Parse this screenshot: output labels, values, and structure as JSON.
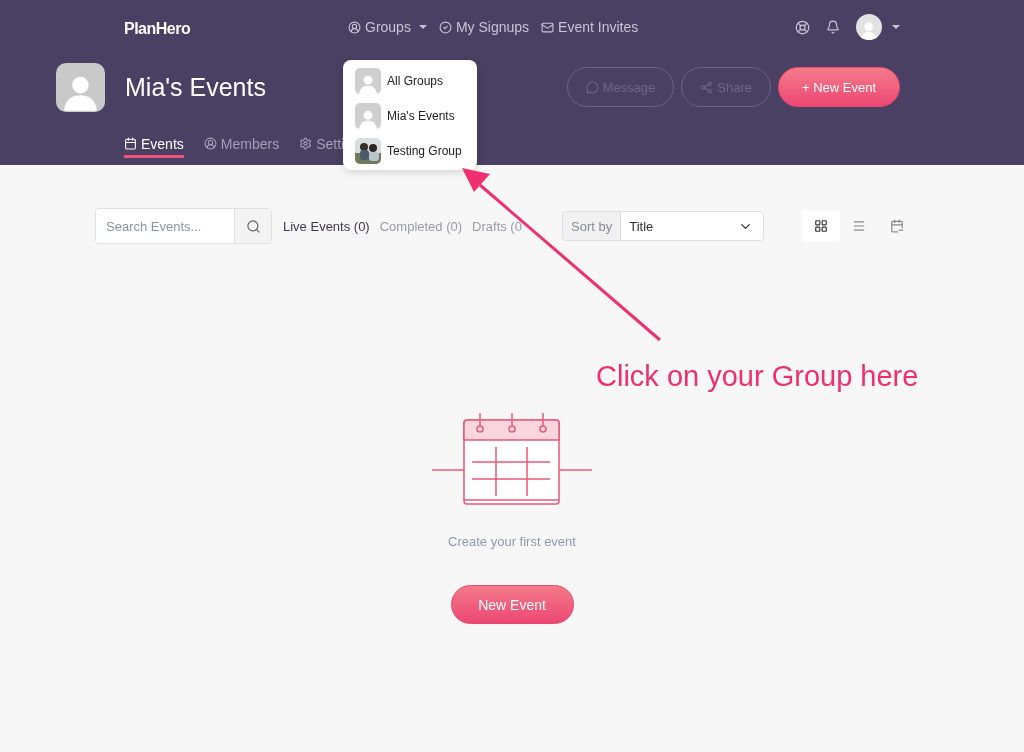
{
  "brand": "PlanHero",
  "nav": [
    {
      "kind": "groups",
      "label": "Groups",
      "caret": true
    },
    {
      "kind": "signups",
      "label": "My Signups",
      "caret": false
    },
    {
      "kind": "invites",
      "label": "Event Invites",
      "caret": false
    }
  ],
  "group": {
    "name": "Mia's Events"
  },
  "actions": [
    {
      "kind": "message",
      "label": "Message"
    },
    {
      "kind": "share",
      "label": "Share"
    },
    {
      "kind": "primary",
      "label": "+ New Event"
    }
  ],
  "tabs": [
    {
      "kind": "events",
      "label": "Events",
      "selected": true
    },
    {
      "kind": "members",
      "label": "Members",
      "selected": false
    },
    {
      "kind": "settings",
      "label": "Setti",
      "selected": false
    }
  ],
  "groups_menu": [
    {
      "label": "All Groups",
      "kind": "placeholder"
    },
    {
      "label": "Mia's Events",
      "kind": "placeholder"
    },
    {
      "label": "Testing Group",
      "kind": "picture"
    }
  ],
  "search": {
    "placeholder": "Search Events..."
  },
  "filters": [
    {
      "label": "Live Events (0)",
      "selected": true
    },
    {
      "label": "Completed (0)",
      "selected": false
    },
    {
      "label": "Drafts (0",
      "selected": false
    }
  ],
  "sort": {
    "label": "Sort by",
    "value": "Title"
  },
  "views": [
    {
      "kind": "grid",
      "selected": true
    },
    {
      "kind": "list",
      "selected": false
    },
    {
      "kind": "calendar",
      "selected": false
    }
  ],
  "empty": {
    "message": "Create your first event",
    "button": "New Event"
  },
  "annotation": {
    "text": "Click on your Group here"
  }
}
